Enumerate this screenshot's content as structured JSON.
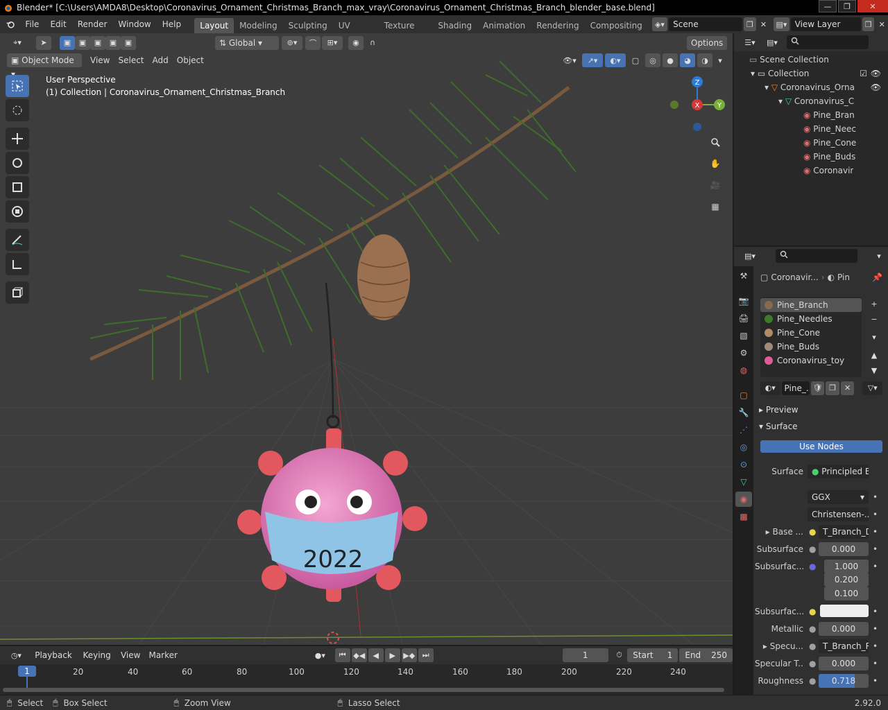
{
  "window": {
    "title": "Blender* [C:\\Users\\AMDA8\\Desktop\\Coronavirus_Ornament_Christmas_Branch_max_vray\\Coronavirus_Ornament_Christmas_Branch_blender_base.blend]",
    "minimize": "—",
    "maximize": "❐",
    "close": "✕"
  },
  "menubar": {
    "items": [
      "File",
      "Edit",
      "Render",
      "Window",
      "Help"
    ]
  },
  "workspaces": {
    "tabs": [
      "Layout",
      "Modeling",
      "Sculpting",
      "UV Editing",
      "Texture Paint",
      "Shading",
      "Animation",
      "Rendering",
      "Compositing"
    ],
    "active": "Layout"
  },
  "scene": {
    "name": "Scene"
  },
  "view_layer": {
    "name": "View Layer"
  },
  "viewport": {
    "transform_orientation": "Global",
    "options_label": "Options",
    "mode": "Object Mode",
    "menus": [
      "View",
      "Select",
      "Add",
      "Object"
    ],
    "overlay_title": "User Perspective",
    "overlay_subtitle": "(1) Collection | Coronavirus_Ornament_Christmas_Branch",
    "ornament_text": "2022",
    "gizmo": {
      "z": "Z",
      "x": "X",
      "y": "Y"
    }
  },
  "outliner": {
    "rows": [
      {
        "label": "Scene Collection"
      },
      {
        "label": "Collection"
      },
      {
        "label": "Coronavirus_Orna"
      },
      {
        "label": "Coronavirus_C"
      },
      {
        "label": "Pine_Bran"
      },
      {
        "label": "Pine_Neec"
      },
      {
        "label": "Pine_Cone"
      },
      {
        "label": "Pine_Buds"
      },
      {
        "label": "Coronavir"
      }
    ]
  },
  "properties": {
    "breadcrumb_object": "Coronavir...",
    "breadcrumb_material": "Pin",
    "material_slots": [
      {
        "name": "Pine_Branch",
        "color": "#8a6a4e"
      },
      {
        "name": "Pine_Needles",
        "color": "#3f7a2c"
      },
      {
        "name": "Pine_Cone",
        "color": "#b38a66"
      },
      {
        "name": "Pine_Buds",
        "color": "#a08a78"
      },
      {
        "name": "Coronavirus_toy",
        "color": "#e05a9a"
      }
    ],
    "material_name": "Pine_...",
    "panels": {
      "preview": "Preview",
      "surface": "Surface"
    },
    "use_nodes": "Use Nodes",
    "surface_label": "Surface",
    "surface_value": "Principled B...",
    "distribution": "GGX",
    "subsurface_method": "Christensen-...",
    "base_color_label": "Base ...",
    "base_color_value": "T_Branch_D...",
    "subsurface_label": "Subsurface",
    "subsurface_value": "0.000",
    "subsurface_radius_label": "Subsurfac...",
    "subsurface_radius": [
      "1.000",
      "0.200",
      "0.100"
    ],
    "subsurface_color_label": "Subsurfac...",
    "metallic_label": "Metallic",
    "metallic_value": "0.000",
    "specular_label": "Specu...",
    "specular_value": "T_Branch_R...",
    "specular_tint_label": "Specular T...",
    "specular_tint_value": "0.000",
    "roughness_label": "Roughness",
    "roughness_value": "0.718",
    "roughness_fraction": 0.718
  },
  "timeline": {
    "menus": [
      "Playback",
      "Keying",
      "View",
      "Marker"
    ],
    "current_frame": "1",
    "start_label": "Start",
    "start_value": "1",
    "end_label": "End",
    "end_value": "250",
    "ruler": [
      "1",
      "20",
      "40",
      "60",
      "80",
      "100",
      "120",
      "140",
      "160",
      "180",
      "200",
      "220",
      "240"
    ]
  },
  "statusbar": {
    "select": "Select",
    "box_select": "Box Select",
    "zoom_view": "Zoom View",
    "lasso_select": "Lasso Select",
    "version": "2.92.0"
  },
  "colors": {
    "accent": "#4772b3",
    "header": "#303030",
    "viewport_bg": "#3d3d3d"
  }
}
